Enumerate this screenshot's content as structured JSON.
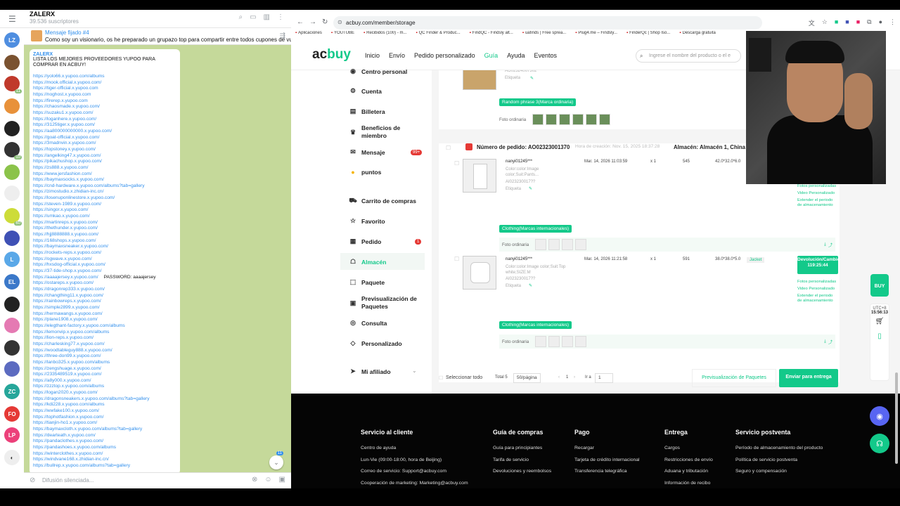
{
  "telegram": {
    "channel_title": "ZALERX",
    "subscribers": "39.536 suscriptores",
    "rail": [
      "LZ",
      "L",
      "EL",
      "ZC",
      "FO",
      "LP"
    ],
    "rail_badges": [
      "11",
      "10",
      "60"
    ],
    "pinned": {
      "label": "Mensaje fijado #4",
      "text": "Como soy un visionario, os he preparado un grupazo top para compartir entre todos cupones de vuestr..."
    },
    "message": {
      "sender": "ZALERX",
      "text": "LISTA LOS MEJORES PROVEEDORES YUPOO PARA COMPRAR EN ACBUY!"
    },
    "links": [
      "https://yolo66.x.yupoo.com/albums",
      "https://mook.official.x.yupoo.com/",
      "https://tiger-official.x.yupoo.com",
      "https://noghost.x.yupoo.com",
      "https://firerep.x.yupoo.com",
      "https://chaosmade.x.yupoo.com/",
      "https://suzaku1.x.yupoo.com/",
      "https://loganhere.x.yupoo.com/",
      "https://3125tiger.x.yupoo.com/",
      "https://aa800000000000.x.yupoo.com/",
      "https://goat-official.x.yupoo.com/",
      "https://3madnvin.x.yupoo.com/",
      "https://topstoney.x.yupoo.com/",
      "https://angelking47.x.yupoo.com/",
      "https://pikachushop.x.yupoo.com/",
      "https://zs888.x.yupoo.com/",
      "https://www.jersfashion.com/",
      "https://baymaxsocks.x.yupoo.com/",
      "https://cnd-hardware.x.yupoo.com/albums?tab=gallery",
      "https://zimostudio.x.zhidian-inc.cn/",
      "https://losenuponlinestore.x.yupoo.com/",
      "https://steven-1989.x.yupoo.com/",
      "https://singor.x.yupoo.com/",
      "https://umkao.x.yupoo.com/",
      "https://martinreps.x.yupoo.com/",
      "https://thethunder.x.yupoo.com/",
      "https://hjj8888888.x.yupoo.com/",
      "https://168shops.x.yupoo.com/",
      "https://baymaxsneaker.x.yupoo.com/",
      "https://rockets-reps.x.yupoo.com/",
      "https://ogwave.x.yupoo.com/",
      "https://hxsdog-official.x.yupoo.com/",
      "https://37-tide-shop.x.yupoo.com/",
      "https://aaaajersey.x.yupoo.com/",
      "https://ostareps.x.yupoo.com/",
      "https://dragonrep333.x.yupoo.com/",
      "https://changthing11.x.yupoo.com/",
      "https://rainbowreps.x.yupoo.com/",
      "https://simple2899.x.yupoo.com/",
      "https://hermawangs.x.yupoo.com/",
      "https://plane1908.x.yupoo.com/",
      "https://elegthant-factory.x.yupoo.com/albums",
      "https://lemonvip.x.yupoo.com/albums",
      "https://lion-reps.x.yupoo.com/",
      "https://charlesking77.x.yupoo.com/",
      "https://woodtableguy888.x.yupoo.com/",
      "https://three-don99.x.yupoo.com/",
      "https://lanbo325.x.yupoo.com/albums",
      "https://zengshuage.x.yupoo.com/",
      "https://2335489519.x.yupoo.com/",
      "https://a8y000.x.yupoo.com/",
      "https://zzztop.x.yupoo.com/albums",
      "https://logan2020.x.yupoo.com/",
      "https://dragonsneakers.x.yupoo.com/albums?tab=gallery",
      "https://kdi228.x.yupoo.com/albums",
      "https://wwfake100.x.yupoo.com/",
      "https://tophotfashion.x.yupoo.com/",
      "https://tianjin-ho1.x.yupoo.com/",
      "https://baymaxcloth.x.yupoo.com/albums?tab=gallery",
      "https://dearteath.x.yupoo.com/",
      "https://pandaclothes.x.yupoo.com/",
      "https://pandashoes.x.yupoo.com/albums",
      "https://winterclothes.x.yupoo.com/",
      "https://windvane168.x.zhidian-inc.cn/",
      "https://bullrep.x.yupoo.com/albums?tab=gallery"
    ],
    "password_note": "PASSWORD: aaaajersey",
    "unread": "11",
    "input_placeholder": "Difusión silenciada..."
  },
  "browser": {
    "url": "acbuy.com/member/storage",
    "bookmarks": [
      "Aplicaciones",
      "YOUTUBE",
      "Recibidos (100) - m...",
      "QC Finder & Produc...",
      "FindQC - Findsly alt...",
      "uafinds | Free sprea...",
      "Plug4.me – Findsly...",
      "FinderQc | Shop Iso...",
      "Descarga gratuita"
    ]
  },
  "site": {
    "logo_a": "ac",
    "logo_b": "buy",
    "menu": [
      "Inicio",
      "Envío",
      "Pedido personalizado",
      "Guía",
      "Ayuda",
      "Eventos"
    ],
    "menu_active": 3,
    "search_placeholder": "Ingrese el nombre del producto o el e",
    "float_label": "BUY",
    "tz": "UTC+8",
    "time": "15:56:13"
  },
  "sidebar": [
    {
      "label": "Centro personal",
      "icon": "user-icon",
      "glyph": "◉"
    },
    {
      "label": "Cuenta",
      "icon": "gear-icon",
      "glyph": "⚙"
    },
    {
      "label": "Billetera",
      "icon": "wallet-icon",
      "glyph": "▤"
    },
    {
      "label": "Beneficios de miembro",
      "icon": "crown-icon",
      "glyph": "♛"
    },
    {
      "label": "Mensaje",
      "icon": "message-icon",
      "glyph": "✉",
      "badge": "99+"
    },
    {
      "label": "puntos",
      "icon": "coin-icon",
      "glyph": "●"
    },
    {
      "label": "Carrito de compras",
      "icon": "cart-icon",
      "glyph": "⛟"
    },
    {
      "label": "Favorito",
      "icon": "star-icon",
      "glyph": "☆"
    },
    {
      "label": "Pedido",
      "icon": "order-icon",
      "glyph": "▦",
      "badge": "1"
    },
    {
      "label": "Almacén",
      "icon": "warehouse-icon",
      "glyph": "☖",
      "active": true
    },
    {
      "label": "Paquete",
      "icon": "package-icon",
      "glyph": "⬚"
    },
    {
      "label": "Previsualización de Paquetes",
      "icon": "preview-icon",
      "glyph": "▣"
    },
    {
      "label": "Consulta",
      "icon": "inquiry-icon",
      "glyph": "◎"
    },
    {
      "label": "Personalizado",
      "icon": "tag-icon",
      "glyph": "◇"
    },
    {
      "label": "Mi afiliado",
      "icon": "affiliate-icon",
      "glyph": "➤",
      "chevron": "⌄"
    }
  ],
  "storage": {
    "photo_label": "Foto ordinaria",
    "actions": [
      "Fotos personalizadas",
      "Video Personalizado",
      "Extender el periodo de almacenamiento"
    ],
    "top": {
      "id": "AO02324007302",
      "label": "Etiqueta",
      "tag": "Random phrase 3(Marca ordinaria)"
    },
    "order": {
      "number": "Número de pedido: AO02323001370",
      "created": "Hora de creación: Nov. 15, 2025 18:37:28",
      "warehouse": "Almacén: Almacén 1, China"
    },
    "items": [
      {
        "seller": "nanyi01245***",
        "attrs": "Color:color:Image color;Suit:Pants...",
        "id": "AI023230017??",
        "label": "Etiqueta",
        "date": "Mar. 14, 2026 11:03:59",
        "qty": "x 1",
        "weight": "545",
        "dims": "42.0*32.0*6.0",
        "tag": "Clothing(Marcas internacionales)"
      },
      {
        "seller": "nanyi01245***",
        "attrs": "Color:color:Image color;Suit:Top white;SIZE:M",
        "id": "AI023230017??",
        "label": "Etiqueta",
        "date": "Mar. 14, 2026 11:21:58",
        "qty": "x 1",
        "weight": "591",
        "dims": "38.0*38.0*5.0",
        "category": "Jacket",
        "return_label": "Devolución/Cambio",
        "return_timer": "119:25:44",
        "tag": "Clothing(Marcas internacionales)"
      }
    ],
    "footer": {
      "select_all": "Seleccionar todo",
      "total": "Total 5",
      "page_size": "50/página",
      "page": "1",
      "goto": "Ir a",
      "goto_value": "1",
      "preview": "Previsualización de Paquetes",
      "submit": "Enviar para entrega"
    }
  },
  "footer": [
    {
      "title": "Servicio al cliente",
      "items": [
        "Centro de ayuda",
        "Lun-Vie (09:00-18:00, hora de Beijing)",
        "Correo de servicio: Support@acbuy.com",
        "Cooperación de marketing: Marketing@acbuy.com"
      ]
    },
    {
      "title": "Guía de compras",
      "items": [
        "Guía para principiantes",
        "Tarifa de servicio",
        "Devoluciones y reembolsos"
      ]
    },
    {
      "title": "Pago",
      "items": [
        "Recargar",
        "Tarjeta de crédito internacional",
        "Transferencia telegráfica"
      ]
    },
    {
      "title": "Entrega",
      "items": [
        "Cargos",
        "Restricciones de envío",
        "Aduana y tributación",
        "Información de recibo"
      ]
    },
    {
      "title": "Servicio postventa",
      "items": [
        "Período de almacenamiento del producto",
        "Política de servicio postventa",
        "Seguro y compensación"
      ]
    }
  ],
  "colors": {
    "accent": "#13c98a",
    "telegram_link": "#3390ec",
    "chat_bg": "#c5d99a",
    "badge": "#e53935"
  }
}
